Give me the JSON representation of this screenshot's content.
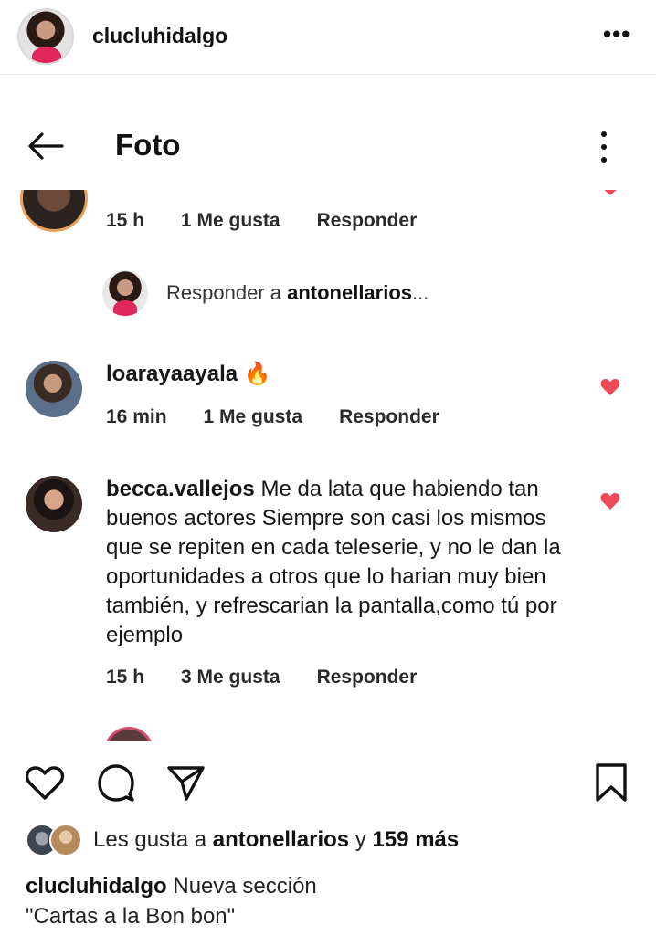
{
  "post": {
    "username": "clucluhidalgo",
    "more_icon": "more-horizontal-icon"
  },
  "screenshot": {
    "app_title": "Foto",
    "first_comment": {
      "time": "15 h",
      "likes": "1 Me gusta",
      "reply": "Responder"
    },
    "reply_prompt": {
      "prefix": "Responder a ",
      "user": "antonellarios",
      "suffix": "..."
    },
    "comment_loaraya": {
      "username": "loarayaayala",
      "emoji": "🔥",
      "time": "16 min",
      "likes": "1 Me gusta",
      "reply": "Responder"
    },
    "comment_becca": {
      "username": "becca.vallejos",
      "text": "Me da lata que habiendo tan buenos actores Siempre son casi los mismos que se repiten en cada teleserie, y no le dan la oportunidades a otros que lo harian muy bien también, y refrescarian la pantalla,como tú por ejemplo",
      "time": "15 h",
      "likes": "3 Me gusta",
      "reply": "Responder"
    },
    "heart_color": "#ed4956"
  },
  "actions": {
    "like_icon": "heart-outline-icon",
    "comment_icon": "comment-icon",
    "share_icon": "send-icon",
    "save_icon": "bookmark-icon"
  },
  "likes": {
    "prefix": "Les gusta a ",
    "user": "antonellarios",
    "conjunction": " y ",
    "count": "159 más"
  },
  "caption": {
    "username": "clucluhidalgo",
    "line1": "Nueva sección",
    "line2": "\"Cartas a la Bon bon\""
  }
}
